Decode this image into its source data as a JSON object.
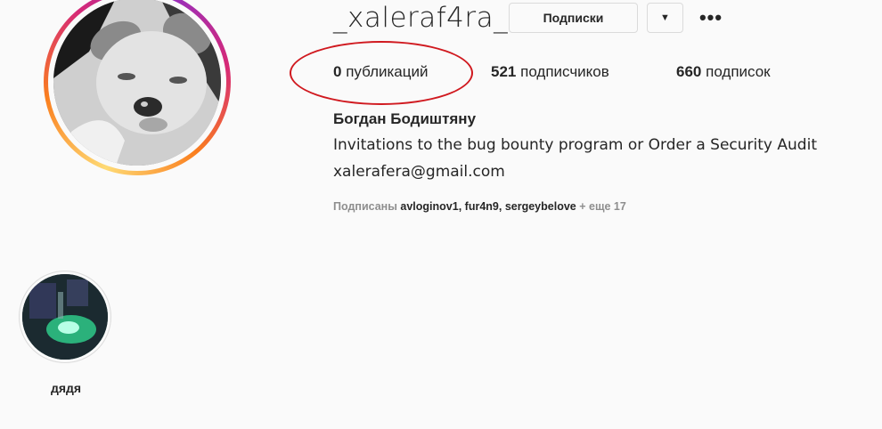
{
  "profile": {
    "username": "_xaleraf4ra_",
    "follow_button": "Подписки",
    "dropdown_icon": "▼",
    "more_icon": "•••",
    "posts_count": "0",
    "posts_label": "публикаций",
    "followers_count": "521",
    "followers_label": "подписчиков",
    "following_count": "660",
    "following_label": "подписок",
    "full_name": "Богдан Бодиштяну",
    "bio": "Invitations to the bug bounty program or Order a Security Audit",
    "email": "xalerafera@gmail.com",
    "followed_by_prefix": "Подписаны",
    "followed_by_users": [
      "avloginov1",
      "fur4n9",
      "sergeybelove"
    ],
    "followed_by_more": "+ еще 17"
  },
  "stories": [
    {
      "label": "дядя"
    }
  ],
  "colors": {
    "annotation": "#d0191f",
    "text": "#262626",
    "muted": "#8e8e8e",
    "border": "#dbdbdb",
    "background": "#fafafa"
  }
}
